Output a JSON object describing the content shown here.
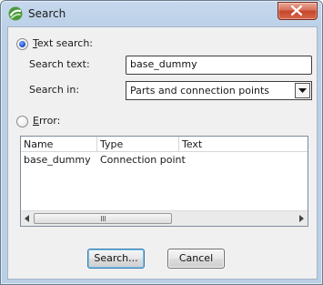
{
  "window": {
    "title": "Search"
  },
  "form": {
    "text_search_option": {
      "label_underlined": "T",
      "label_rest": "ext search:",
      "selected": true
    },
    "search_text_label": "Search text:",
    "search_text_value": "base_dummy",
    "search_in_label": "Search in:",
    "search_in_value": "Parts and connection points",
    "error_option": {
      "label_underlined": "E",
      "label_rest": "rror:",
      "selected": false
    }
  },
  "results": {
    "columns": [
      "Name",
      "Type",
      "Text"
    ],
    "rows": [
      [
        "base_dummy",
        "Connection point",
        ""
      ]
    ]
  },
  "buttons": {
    "search": "Search...",
    "cancel": "Cancel"
  },
  "icons": {
    "app": "search-app-icon",
    "close": "close-icon",
    "dropdown": "chevron-down-icon",
    "scroll_left": "arrow-left-icon",
    "scroll_right": "arrow-right-icon"
  },
  "colors": {
    "accent": "#1f4fd1",
    "close": "#c4452a",
    "titlebar": "#bcd1e8"
  }
}
